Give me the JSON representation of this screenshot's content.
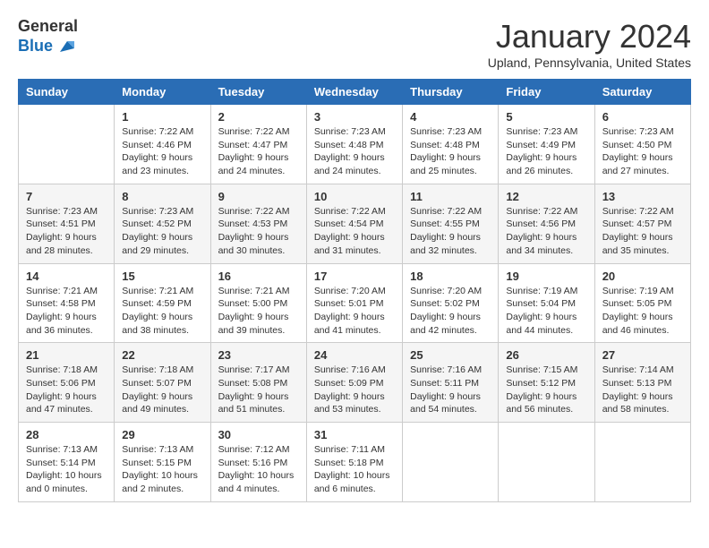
{
  "logo": {
    "general": "General",
    "blue": "Blue"
  },
  "header": {
    "month": "January 2024",
    "location": "Upland, Pennsylvania, United States"
  },
  "weekdays": [
    "Sunday",
    "Monday",
    "Tuesday",
    "Wednesday",
    "Thursday",
    "Friday",
    "Saturday"
  ],
  "weeks": [
    [
      {
        "day": "",
        "info": ""
      },
      {
        "day": "1",
        "info": "Sunrise: 7:22 AM\nSunset: 4:46 PM\nDaylight: 9 hours\nand 23 minutes."
      },
      {
        "day": "2",
        "info": "Sunrise: 7:22 AM\nSunset: 4:47 PM\nDaylight: 9 hours\nand 24 minutes."
      },
      {
        "day": "3",
        "info": "Sunrise: 7:23 AM\nSunset: 4:48 PM\nDaylight: 9 hours\nand 24 minutes."
      },
      {
        "day": "4",
        "info": "Sunrise: 7:23 AM\nSunset: 4:48 PM\nDaylight: 9 hours\nand 25 minutes."
      },
      {
        "day": "5",
        "info": "Sunrise: 7:23 AM\nSunset: 4:49 PM\nDaylight: 9 hours\nand 26 minutes."
      },
      {
        "day": "6",
        "info": "Sunrise: 7:23 AM\nSunset: 4:50 PM\nDaylight: 9 hours\nand 27 minutes."
      }
    ],
    [
      {
        "day": "7",
        "info": "Sunrise: 7:23 AM\nSunset: 4:51 PM\nDaylight: 9 hours\nand 28 minutes."
      },
      {
        "day": "8",
        "info": "Sunrise: 7:23 AM\nSunset: 4:52 PM\nDaylight: 9 hours\nand 29 minutes."
      },
      {
        "day": "9",
        "info": "Sunrise: 7:22 AM\nSunset: 4:53 PM\nDaylight: 9 hours\nand 30 minutes."
      },
      {
        "day": "10",
        "info": "Sunrise: 7:22 AM\nSunset: 4:54 PM\nDaylight: 9 hours\nand 31 minutes."
      },
      {
        "day": "11",
        "info": "Sunrise: 7:22 AM\nSunset: 4:55 PM\nDaylight: 9 hours\nand 32 minutes."
      },
      {
        "day": "12",
        "info": "Sunrise: 7:22 AM\nSunset: 4:56 PM\nDaylight: 9 hours\nand 34 minutes."
      },
      {
        "day": "13",
        "info": "Sunrise: 7:22 AM\nSunset: 4:57 PM\nDaylight: 9 hours\nand 35 minutes."
      }
    ],
    [
      {
        "day": "14",
        "info": "Sunrise: 7:21 AM\nSunset: 4:58 PM\nDaylight: 9 hours\nand 36 minutes."
      },
      {
        "day": "15",
        "info": "Sunrise: 7:21 AM\nSunset: 4:59 PM\nDaylight: 9 hours\nand 38 minutes."
      },
      {
        "day": "16",
        "info": "Sunrise: 7:21 AM\nSunset: 5:00 PM\nDaylight: 9 hours\nand 39 minutes."
      },
      {
        "day": "17",
        "info": "Sunrise: 7:20 AM\nSunset: 5:01 PM\nDaylight: 9 hours\nand 41 minutes."
      },
      {
        "day": "18",
        "info": "Sunrise: 7:20 AM\nSunset: 5:02 PM\nDaylight: 9 hours\nand 42 minutes."
      },
      {
        "day": "19",
        "info": "Sunrise: 7:19 AM\nSunset: 5:04 PM\nDaylight: 9 hours\nand 44 minutes."
      },
      {
        "day": "20",
        "info": "Sunrise: 7:19 AM\nSunset: 5:05 PM\nDaylight: 9 hours\nand 46 minutes."
      }
    ],
    [
      {
        "day": "21",
        "info": "Sunrise: 7:18 AM\nSunset: 5:06 PM\nDaylight: 9 hours\nand 47 minutes."
      },
      {
        "day": "22",
        "info": "Sunrise: 7:18 AM\nSunset: 5:07 PM\nDaylight: 9 hours\nand 49 minutes."
      },
      {
        "day": "23",
        "info": "Sunrise: 7:17 AM\nSunset: 5:08 PM\nDaylight: 9 hours\nand 51 minutes."
      },
      {
        "day": "24",
        "info": "Sunrise: 7:16 AM\nSunset: 5:09 PM\nDaylight: 9 hours\nand 53 minutes."
      },
      {
        "day": "25",
        "info": "Sunrise: 7:16 AM\nSunset: 5:11 PM\nDaylight: 9 hours\nand 54 minutes."
      },
      {
        "day": "26",
        "info": "Sunrise: 7:15 AM\nSunset: 5:12 PM\nDaylight: 9 hours\nand 56 minutes."
      },
      {
        "day": "27",
        "info": "Sunrise: 7:14 AM\nSunset: 5:13 PM\nDaylight: 9 hours\nand 58 minutes."
      }
    ],
    [
      {
        "day": "28",
        "info": "Sunrise: 7:13 AM\nSunset: 5:14 PM\nDaylight: 10 hours\nand 0 minutes."
      },
      {
        "day": "29",
        "info": "Sunrise: 7:13 AM\nSunset: 5:15 PM\nDaylight: 10 hours\nand 2 minutes."
      },
      {
        "day": "30",
        "info": "Sunrise: 7:12 AM\nSunset: 5:16 PM\nDaylight: 10 hours\nand 4 minutes."
      },
      {
        "day": "31",
        "info": "Sunrise: 7:11 AM\nSunset: 5:18 PM\nDaylight: 10 hours\nand 6 minutes."
      },
      {
        "day": "",
        "info": ""
      },
      {
        "day": "",
        "info": ""
      },
      {
        "day": "",
        "info": ""
      }
    ]
  ]
}
